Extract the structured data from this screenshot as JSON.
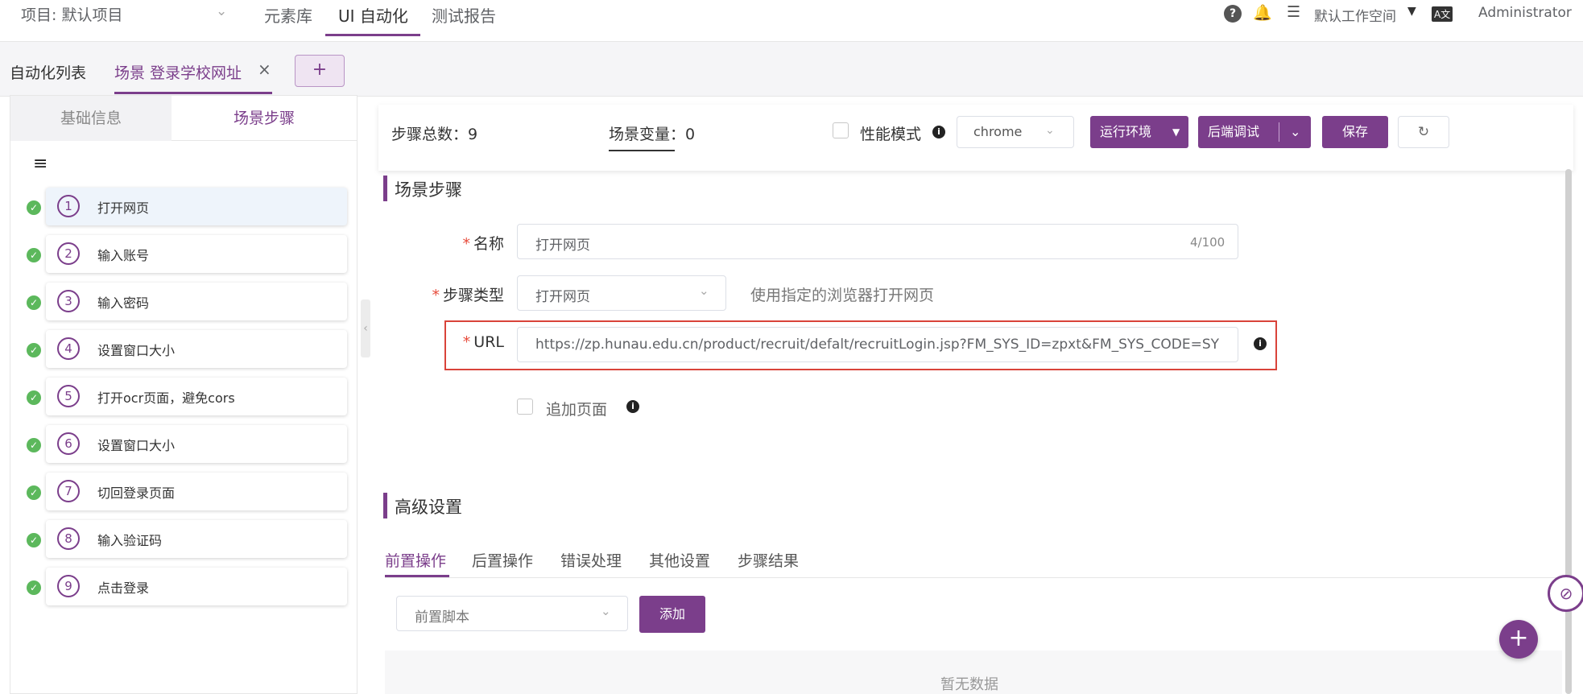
{
  "topbar": {
    "project": "项目: 默认项目",
    "nav": [
      "元素库",
      "UI 自动化",
      "测试报告"
    ],
    "workspace": "默认工作空间",
    "user": "Administrator"
  },
  "tabs": {
    "list_tab": "自动化列表",
    "scene_tab": "场景 登录学校网址",
    "close": "×",
    "add": "+"
  },
  "left_panel": {
    "tab_basic": "基础信息",
    "tab_steps": "场景步骤",
    "steps": [
      {
        "num": "1",
        "label": "打开网页"
      },
      {
        "num": "2",
        "label": "输入账号"
      },
      {
        "num": "3",
        "label": "输入密码"
      },
      {
        "num": "4",
        "label": "设置窗口大小"
      },
      {
        "num": "5",
        "label": "打开ocr页面，避免cors"
      },
      {
        "num": "6",
        "label": "设置窗口大小"
      },
      {
        "num": "7",
        "label": "切回登录页面"
      },
      {
        "num": "8",
        "label": "输入验证码"
      },
      {
        "num": "9",
        "label": "点击登录"
      }
    ]
  },
  "toolbar": {
    "total_steps": "步骤总数：9",
    "scene_vars": "场景变量：0",
    "perf_mode": "性能模式",
    "browser": "chrome",
    "run_env": "运行环境",
    "backend_debug": "后端调试",
    "save": "保存"
  },
  "form": {
    "section_title": "场景步骤",
    "name_label": "名称",
    "name_value": "打开网页",
    "name_count": "4/100",
    "type_label": "步骤类型",
    "type_value": "打开网页",
    "type_hint": "使用指定的浏览器打开网页",
    "url_label": "URL",
    "url_value": "https://zp.hunau.edu.cn/product/recruit/defalt/recruitLogin.jsp?FM_SYS_ID=zpxt&FM_SYS_CODE=SY",
    "append_page": "追加页面"
  },
  "advanced": {
    "title": "高级设置",
    "tabs": [
      "前置操作",
      "后置操作",
      "错误处理",
      "其他设置",
      "步骤结果"
    ],
    "script_select": "前置脚本",
    "add_button": "添加",
    "empty": "暂无数据"
  },
  "colors": {
    "accent": "#7b3e8b",
    "success": "#5cb85c",
    "highlight": "#d9433a"
  }
}
